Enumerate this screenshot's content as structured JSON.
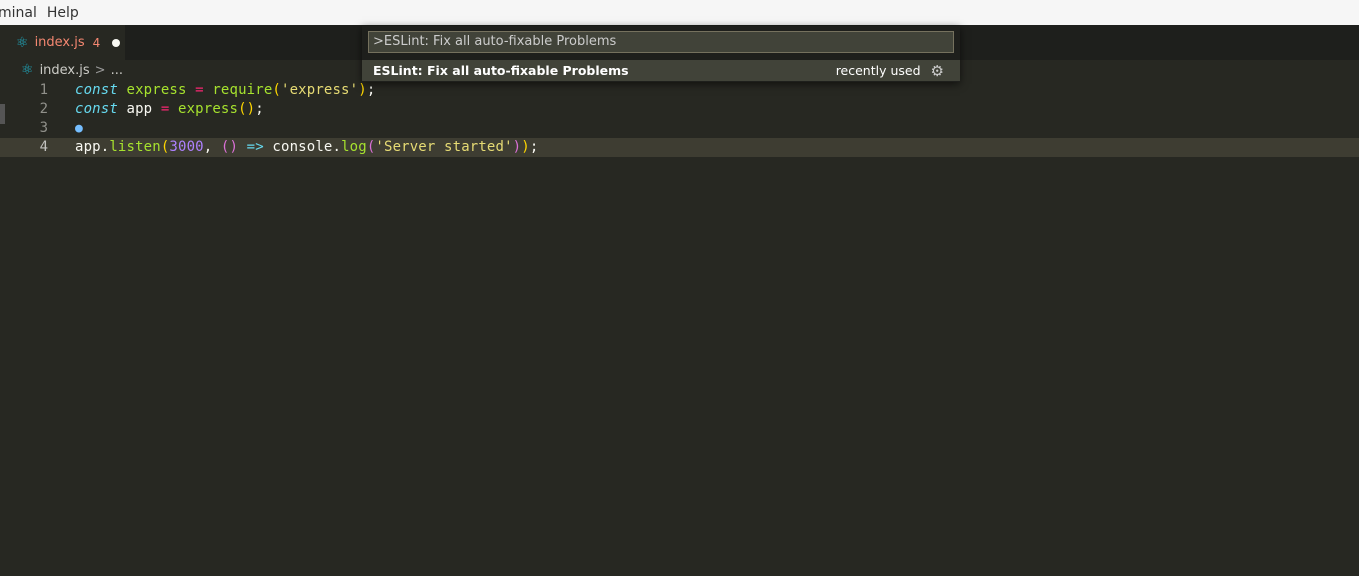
{
  "menubar": {
    "items": [
      "minal",
      "Help"
    ]
  },
  "tab": {
    "name": "index.js",
    "problems": "4"
  },
  "breadcrumb": {
    "file": "index.js",
    "sep": ">",
    "more": "..."
  },
  "editor": {
    "line_numbers": [
      "1",
      "2",
      "3",
      "4"
    ]
  },
  "palette": {
    "input_value": ">ESLint: Fix all auto-fixable Problems",
    "result_label": "ESLint: Fix all auto-fixable Problems",
    "result_hint": "recently used"
  },
  "colors": {
    "background": "#272822",
    "keyword": "#66d9ef",
    "string": "#e6db74",
    "number": "#ae81ff",
    "operator": "#f92672",
    "function": "#a6e22e"
  }
}
